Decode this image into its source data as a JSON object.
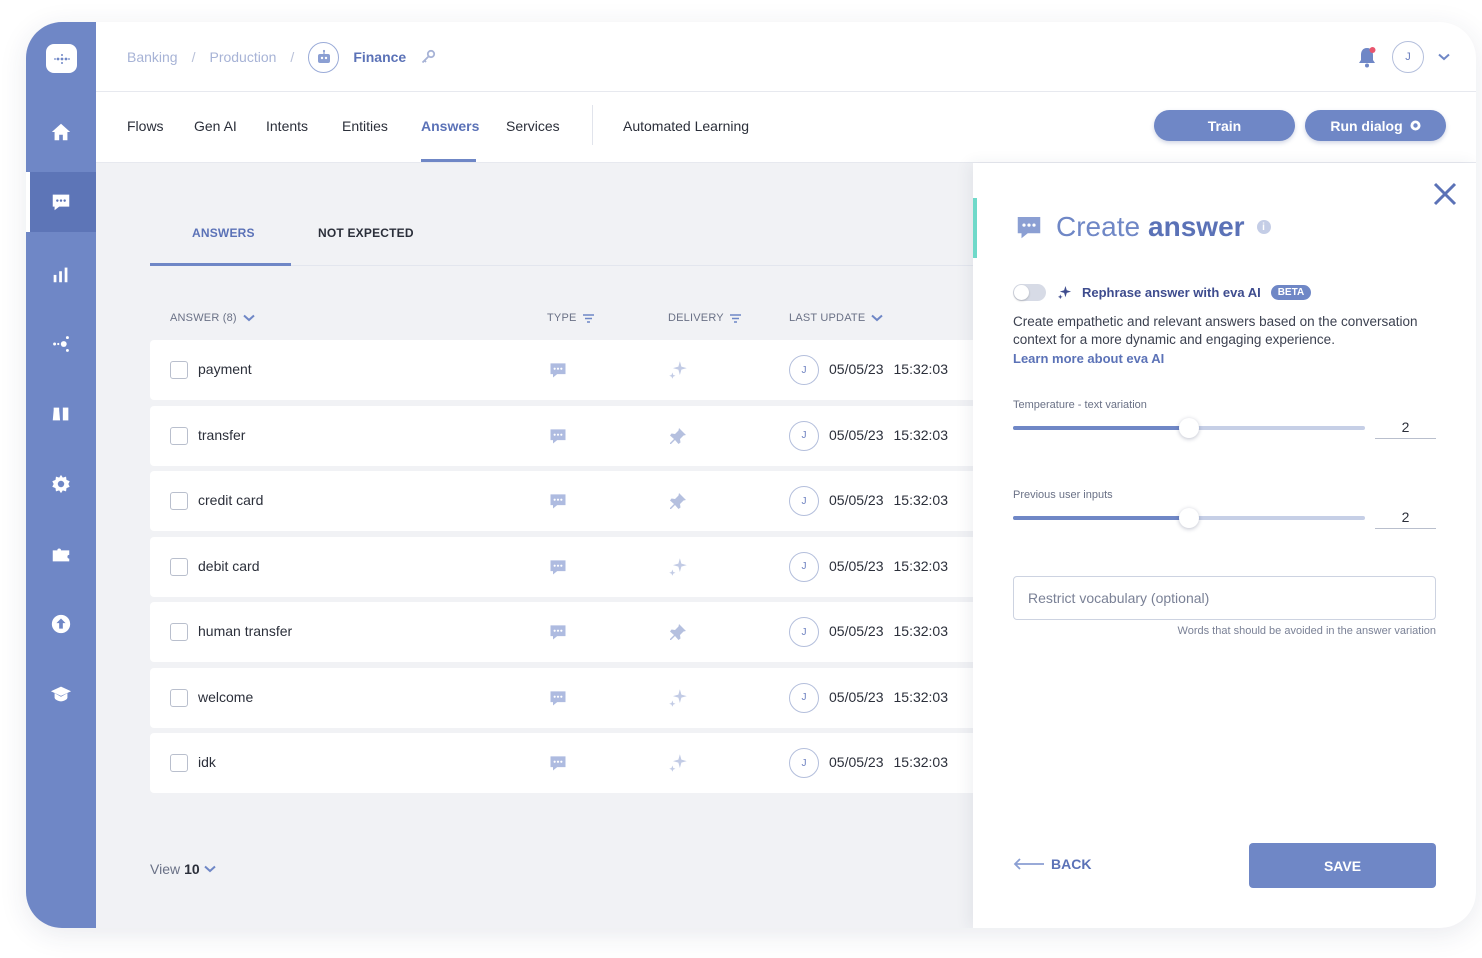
{
  "app": {
    "accent": "#6f87c6",
    "accent_dark": "#5b72b7"
  },
  "breadcrumb": {
    "items": [
      "Banking",
      "Production"
    ],
    "separator": "/",
    "current": "Finance",
    "bot_icon": "robot-icon",
    "edit_icon": "key-icon"
  },
  "user": {
    "initial": "J",
    "notification_icon": "bell-icon"
  },
  "sidebar": {
    "items": [
      {
        "icon": "home-icon"
      },
      {
        "icon": "chat-icon",
        "active": true
      },
      {
        "icon": "bar-chart-icon"
      },
      {
        "icon": "share-nodes-icon"
      },
      {
        "icon": "lab-flask-icon"
      },
      {
        "icon": "gear-icon"
      },
      {
        "icon": "puzzle-icon"
      },
      {
        "icon": "upload-icon"
      },
      {
        "icon": "graduation-cap-icon"
      }
    ]
  },
  "nav": {
    "tabs": [
      "Flows",
      "Gen AI",
      "Intents",
      "Entities",
      "Answers",
      "Services",
      "Automated Learning"
    ],
    "active_tab": "Answers",
    "train_label": "Train",
    "run_dialog_label": "Run dialog"
  },
  "subtabs": {
    "answers": "ANSWERS",
    "not_expected": "NOT EXPECTED"
  },
  "table": {
    "headers": {
      "answer": "ANSWER (8)",
      "type": "TYPE",
      "delivery": "DELIVERY",
      "last_update": "LAST UPDATE"
    },
    "rows": [
      {
        "name": "payment",
        "delivery_icon": "sparkle-icon",
        "user": "J",
        "date": "05/05/23",
        "time": "15:32:03"
      },
      {
        "name": "transfer",
        "delivery_icon": "pin-icon",
        "user": "J",
        "date": "05/05/23",
        "time": "15:32:03"
      },
      {
        "name": "credit card",
        "delivery_icon": "pin-icon",
        "user": "J",
        "date": "05/05/23",
        "time": "15:32:03"
      },
      {
        "name": "debit card",
        "delivery_icon": "sparkle-icon",
        "user": "J",
        "date": "05/05/23",
        "time": "15:32:03"
      },
      {
        "name": "human transfer",
        "delivery_icon": "pin-icon",
        "user": "J",
        "date": "05/05/23",
        "time": "15:32:03"
      },
      {
        "name": "welcome",
        "delivery_icon": "sparkle-icon",
        "user": "J",
        "date": "05/05/23",
        "time": "15:32:03"
      },
      {
        "name": "idk",
        "delivery_icon": "sparkle-icon",
        "user": "J",
        "date": "05/05/23",
        "time": "15:32:03"
      }
    ],
    "view_label": "View",
    "view_count": "10"
  },
  "panel": {
    "title_light": "Create",
    "title_bold": "answer",
    "info_glyph": "i",
    "rephrase_label": "Rephrase answer with eva AI",
    "beta_label": "BETA",
    "rephrase_enabled": false,
    "description": "Create empathetic and relevant answers based on the conversation context for a more dynamic and engaging experience.",
    "learn_more": "Learn more about eva AI",
    "temperature_label": "Temperature - text variation",
    "temperature_value": "2",
    "temperature_fraction": 0.5,
    "previous_inputs_label": "Previous user inputs",
    "previous_inputs_value": "2",
    "previous_inputs_fraction": 0.5,
    "vocab_placeholder": "Restrict vocabulary (optional)",
    "vocab_hint": "Words that should be avoided in the answer variation",
    "back_label": "BACK",
    "save_label": "SAVE"
  }
}
